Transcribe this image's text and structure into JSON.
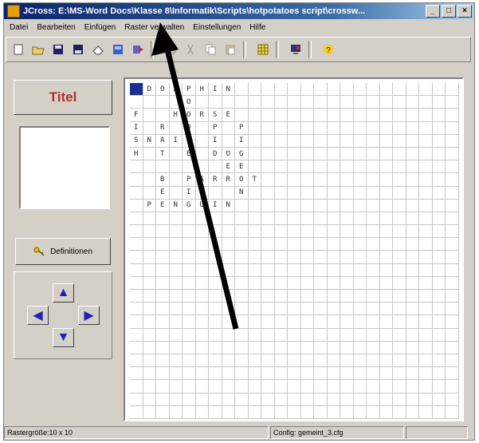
{
  "window": {
    "title": "JCross: E:\\MS-Word Docs\\Klasse 8\\Informatik\\Scripts\\hotpotatoes script\\crossw...",
    "controls": [
      "_",
      "□",
      "×"
    ]
  },
  "menu": [
    "Datei",
    "Bearbeiten",
    "Einfügen",
    "Raster verwalten",
    "Einstellungen",
    "Hilfe"
  ],
  "left_panel": {
    "title_button": "Titel",
    "definitions_button": "Definitionen"
  },
  "grid": {
    "cols": 25,
    "rows": 26,
    "letters": [
      [
        0,
        1,
        "D"
      ],
      [
        0,
        2,
        "O"
      ],
      [
        0,
        3,
        "L"
      ],
      [
        0,
        4,
        "P"
      ],
      [
        0,
        5,
        "H"
      ],
      [
        0,
        6,
        "I"
      ],
      [
        0,
        7,
        "N"
      ],
      [
        1,
        4,
        "O"
      ],
      [
        2,
        0,
        "F"
      ],
      [
        2,
        3,
        "H"
      ],
      [
        2,
        4,
        "O"
      ],
      [
        2,
        5,
        "R"
      ],
      [
        2,
        6,
        "S"
      ],
      [
        2,
        7,
        "E"
      ],
      [
        3,
        0,
        "I"
      ],
      [
        3,
        2,
        "R"
      ],
      [
        3,
        4,
        "D"
      ],
      [
        3,
        6,
        "P"
      ],
      [
        3,
        8,
        "P"
      ],
      [
        4,
        0,
        "S"
      ],
      [
        4,
        1,
        "N"
      ],
      [
        4,
        2,
        "A"
      ],
      [
        4,
        3,
        "I"
      ],
      [
        4,
        4,
        "L"
      ],
      [
        4,
        6,
        "I"
      ],
      [
        4,
        8,
        "I"
      ],
      [
        5,
        0,
        "H"
      ],
      [
        5,
        2,
        "T"
      ],
      [
        5,
        4,
        "E"
      ],
      [
        5,
        6,
        "D"
      ],
      [
        5,
        7,
        "O"
      ],
      [
        5,
        8,
        "G"
      ],
      [
        6,
        7,
        "E"
      ],
      [
        6,
        8,
        "E"
      ],
      [
        7,
        2,
        "B"
      ],
      [
        7,
        4,
        "P"
      ],
      [
        7,
        5,
        "A"
      ],
      [
        7,
        6,
        "R"
      ],
      [
        7,
        7,
        "R"
      ],
      [
        7,
        8,
        "O"
      ],
      [
        7,
        9,
        "T"
      ],
      [
        8,
        2,
        "E"
      ],
      [
        8,
        4,
        "I"
      ],
      [
        8,
        8,
        "N"
      ],
      [
        9,
        1,
        "P"
      ],
      [
        9,
        2,
        "E"
      ],
      [
        9,
        3,
        "N"
      ],
      [
        9,
        4,
        "G"
      ],
      [
        9,
        5,
        "U"
      ],
      [
        9,
        6,
        "I"
      ],
      [
        9,
        7,
        "N"
      ]
    ]
  },
  "status": {
    "grid_size": "Rastergröße:10 x 10",
    "config": "Config: gemeint_3.cfg"
  },
  "icons": {
    "toolbar": [
      "new-icon",
      "open-icon",
      "save-icon",
      "save-as-icon",
      "eraser-icon",
      "web-icon",
      "export-icon",
      "undo-icon",
      "cut-icon",
      "copy-icon",
      "paste-icon",
      "grid-icon",
      "screen-icon",
      "help-icon"
    ]
  }
}
